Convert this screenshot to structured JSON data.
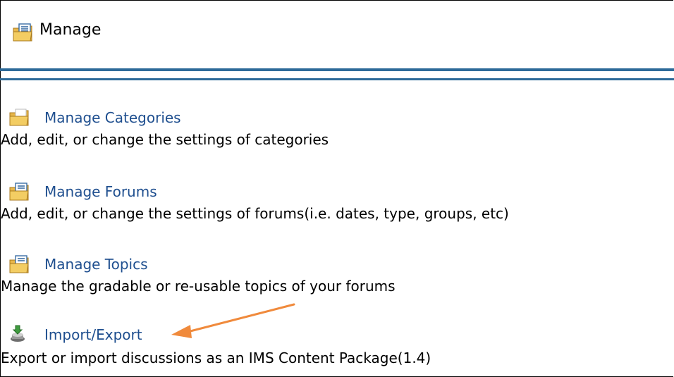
{
  "header": {
    "title": "Manage",
    "icon": "folder-document-icon"
  },
  "items": [
    {
      "label": "Manage Categories",
      "description": "Add, edit, or change the settings of categories",
      "icon": "folder-icon"
    },
    {
      "label": "Manage Forums",
      "description": "Add, edit, or change the settings of forums(i.e. dates, type, groups, etc)",
      "icon": "folder-document-icon"
    },
    {
      "label": "Manage Topics",
      "description": "Manage the gradable or re-usable topics of your forums",
      "icon": "folder-document-icon"
    },
    {
      "label": "Import/Export",
      "description": "Export or import discussions as an IMS Content Package(1.4)",
      "icon": "import-export-icon"
    }
  ],
  "colors": {
    "accent": "#2d6a99",
    "link": "#1f4f8f",
    "annotation_arrow": "#f08a3c"
  }
}
